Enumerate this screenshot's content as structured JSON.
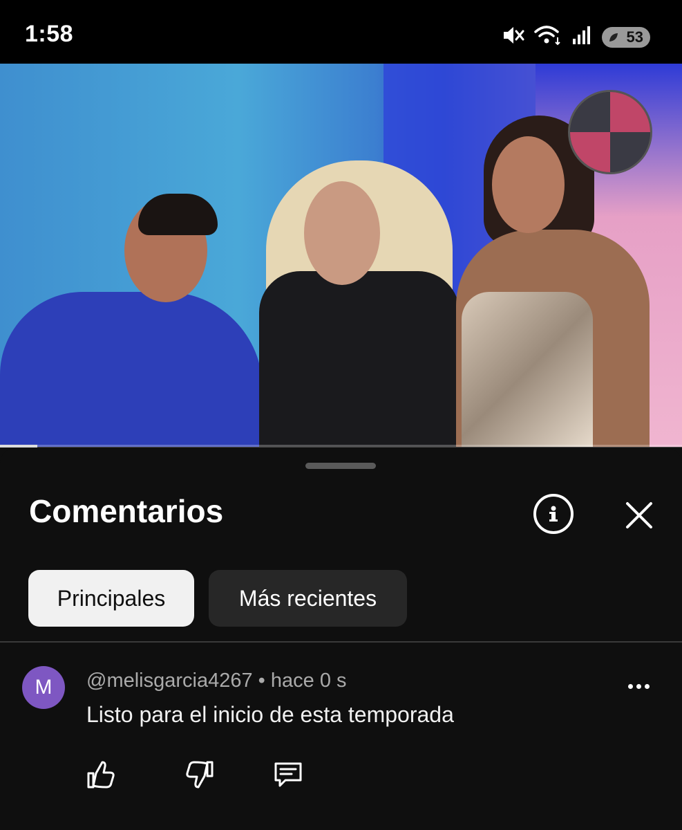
{
  "status_bar": {
    "time": "1:58",
    "icons": [
      "mute-icon",
      "wifi-icon",
      "signal-icon"
    ],
    "battery_level": "53"
  },
  "video": {
    "progress_fraction": 0.055
  },
  "comments_sheet": {
    "title": "Comentarios",
    "info_icon": "info-icon",
    "close_icon": "close-icon",
    "sort_chips": [
      {
        "label": "Principales",
        "selected": true
      },
      {
        "label": "Más recientes",
        "selected": false
      }
    ],
    "comments": [
      {
        "avatar_letter": "M",
        "avatar_color": "#7e57c2",
        "author": "@melisgarcia4267",
        "separator": "•",
        "time": "hace 0 s",
        "text": "Listo para el inicio de esta temporada",
        "actions": [
          "like-icon",
          "dislike-icon",
          "reply-icon"
        ]
      }
    ]
  },
  "colors": {
    "background": "#0f0f0f",
    "chip_selected_bg": "#f1f1f1",
    "chip_bg": "#272727",
    "secondary_text": "#aaaaaa"
  }
}
